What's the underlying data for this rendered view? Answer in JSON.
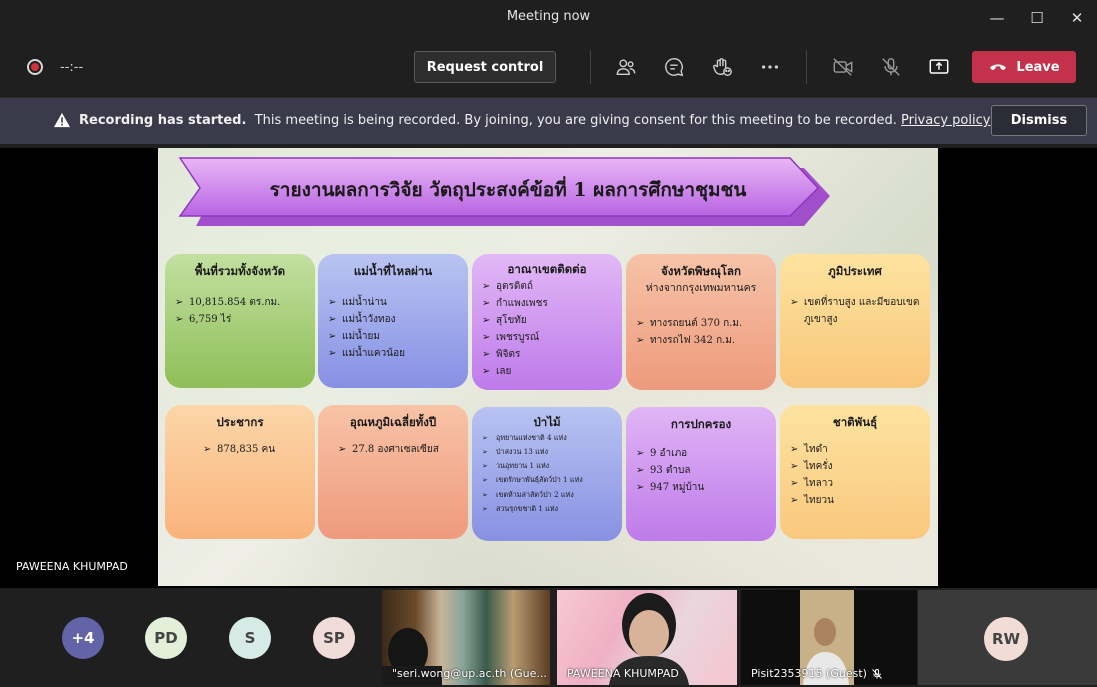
{
  "window": {
    "title": "Meeting now",
    "minimize_glyph": "—",
    "maximize_glyph": "☐",
    "close_glyph": "✕"
  },
  "toolbar": {
    "timer": "--:--",
    "request_control": "Request control",
    "icons": [
      "participants-icon",
      "chat-icon",
      "reactions-icon",
      "more-options-icon",
      "camera-off-icon",
      "mic-off-icon",
      "share-screen-icon"
    ],
    "leave": "Leave"
  },
  "banner": {
    "title": "Recording has started.",
    "message": "This meeting is being recorded. By joining, you are giving consent for this meeting to be recorded.",
    "link": "Privacy policy",
    "dismiss": "Dismiss"
  },
  "stage": {
    "presenter": "PAWEENA KHUMPAD",
    "slide": {
      "title": "รายงานผลการวิจัย วัตถุประสงค์ข้อที่ 1 ผลการศึกษาชุมชน",
      "cards": [
        {
          "title": "พื้นที่รวมทั้งจังหวัด",
          "items": [
            "10,815.854 ตร.กม.",
            "6,759 ไร่"
          ]
        },
        {
          "title": "แม่น้ำที่ไหลผ่าน",
          "items": [
            "แม่น้ำน่าน",
            "แม่น้ำวังทอง",
            "แม่น้ำยม",
            "แม่น้ำแควน้อย"
          ]
        },
        {
          "title": "อาณาเขตติดต่อ",
          "items": [
            "อุตรดิตถ์",
            "กำแพงเพชร",
            "สุโขทัย",
            "เพชรบูรณ์",
            "พิจิตร",
            "เลย"
          ]
        },
        {
          "title": "จังหวัดพิษณุโลก",
          "subtitle": "ห่างจากกรุงเทพมหานคร",
          "items": [
            "ทางรถยนต์ 370 ก.ม.",
            "ทางรถไฟ 342 ก.ม."
          ]
        },
        {
          "title": "ภูมิประเทศ",
          "items": [
            "เขตที่ราบสูง และมีขอบเขตภูเขาสูง"
          ]
        },
        {
          "title": "ประชากร",
          "items": [
            "878,835 คน"
          ]
        },
        {
          "title": "อุณหภูมิเฉลี่ยทั้งปี",
          "items": [
            "27.8 องศาเซลเซียส"
          ]
        },
        {
          "title": "ป่าไม้",
          "items": [
            "อุทยานแห่งชาติ 4 แห่ง",
            "ป่าสงวน 13 แห่ง",
            "วนอุทยาน 1 แห่ง",
            "เขตรักษาพันธุ์สัตว์ป่า 1 แห่ง",
            "เขตห้ามล่าสัตว์ป่า 2 แห่ง",
            "สวนรุกขชาติ 1 แห่ง"
          ]
        },
        {
          "title": "การปกครอง",
          "items": [
            "9 อำเภอ",
            "93 ตำบล",
            "947 หมู่บ้าน"
          ]
        },
        {
          "title": "ชาติพันธุ์",
          "items": [
            "ไทดำ",
            "ไทครั่ง",
            "ไทลาว",
            "ไทยวน"
          ]
        }
      ]
    }
  },
  "participants": {
    "avatars": [
      {
        "initials": "+4",
        "bg": "#6264a7",
        "fg": "#ffffff"
      },
      {
        "initials": "PD",
        "bg": "#e3efd9",
        "fg": "#444444"
      },
      {
        "initials": "S",
        "bg": "#d7ebe6",
        "fg": "#444444"
      },
      {
        "initials": "SP",
        "bg": "#f0dcd8",
        "fg": "#444444"
      }
    ],
    "videos": [
      {
        "name": "\"seri.wong@up.ac.th (Gue..."
      },
      {
        "name": "PAWEENA KHUMPAD"
      },
      {
        "name": "Pisit2353915 (Guest)"
      }
    ],
    "rw": {
      "initials": "RW",
      "bg": "#f2dcd6"
    }
  },
  "colors": {
    "leave": "#c4314b",
    "accent": "#6264a7",
    "banner_bg": "#3a3a4a"
  }
}
